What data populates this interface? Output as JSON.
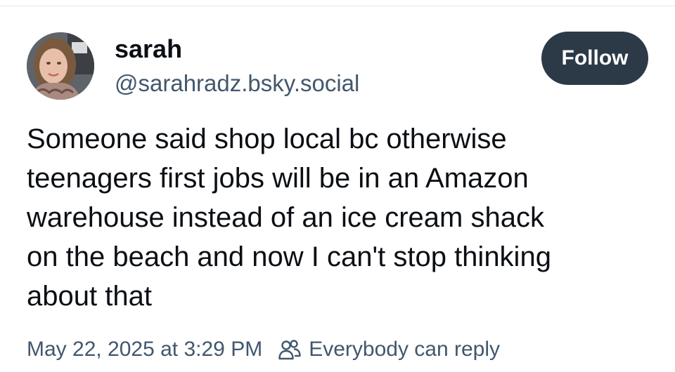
{
  "author": {
    "display_name": "sarah",
    "handle": "@sarahradz.bsky.social"
  },
  "follow_button": {
    "label": "Follow"
  },
  "post": {
    "lines": [
      "Someone said shop local bc otherwise",
      "teenagers first jobs will be in an Amazon",
      "warehouse instead of an ice cream shack",
      "on the beach and now I can't stop thinking",
      "about that"
    ],
    "timestamp": "May 22, 2025 at 3:29 PM",
    "reply_setting": "Everybody can reply"
  },
  "icons": {
    "reply_setting_icon": "people-icon"
  },
  "colors": {
    "follow_button_bg": "#2c3a48",
    "secondary_text": "#42576c"
  }
}
